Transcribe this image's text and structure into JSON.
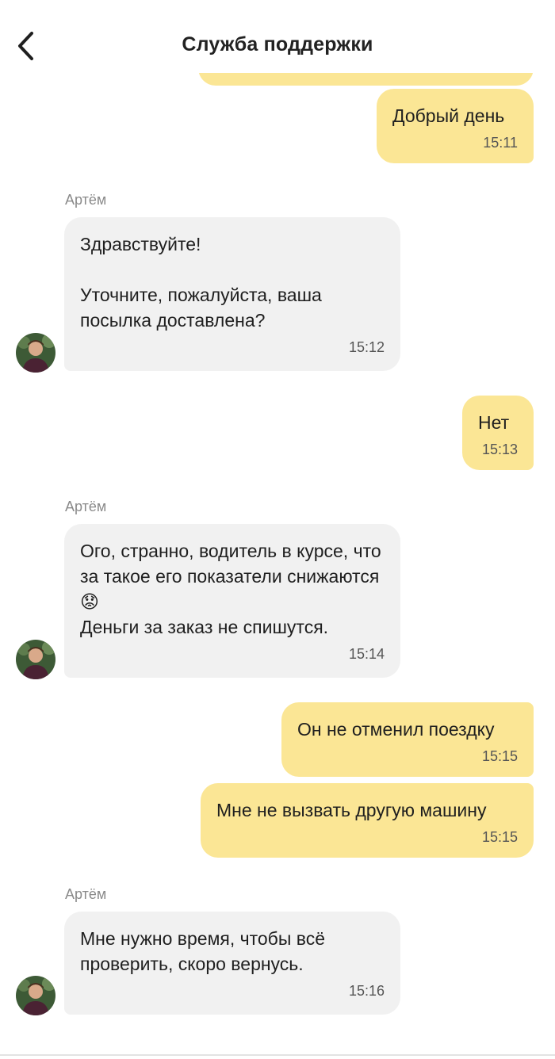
{
  "header": {
    "title": "Служба поддержки"
  },
  "colors": {
    "outgoing_bubble": "#fbe695",
    "incoming_bubble": "#f1f1f1"
  },
  "icons": {
    "back": "chevron-left-icon",
    "avatar": "avatar-photo"
  },
  "messages": [
    {
      "direction": "out",
      "text": "Добрый день",
      "time": "15:11"
    },
    {
      "direction": "in",
      "sender": "Артём",
      "text": "Здравствуйте!\n\nУточните, пожалуйста, ваша посылка доставлена?",
      "time": "15:12"
    },
    {
      "direction": "out",
      "text": "Нет",
      "time": "15:13"
    },
    {
      "direction": "in",
      "sender": "Артём",
      "text": "Ого, странно, водитель в курсе, что за такое его показатели снижаются ",
      "text2": "Деньги за заказ не спишутся.",
      "emoji": "😟",
      "time": "15:14"
    },
    {
      "direction": "out",
      "text": "Он не отменил поездку",
      "time": "15:15"
    },
    {
      "direction": "out",
      "text": "Мне не вызвать другую машину",
      "time": "15:15"
    },
    {
      "direction": "in",
      "sender": "Артём",
      "text": "Мне нужно время, чтобы всё проверить, скоро вернусь.",
      "time": "15:16"
    }
  ]
}
